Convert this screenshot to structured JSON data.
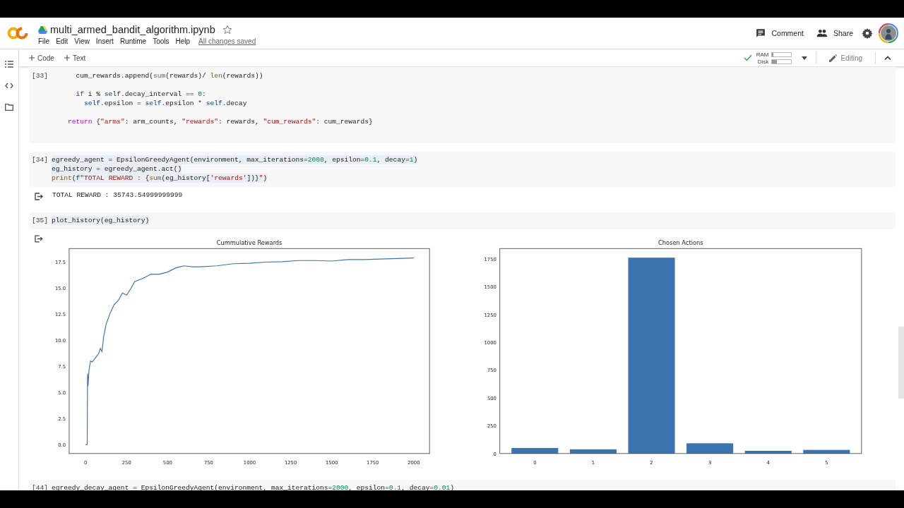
{
  "header": {
    "title": "multi_armed_bandit_algorithm.ipynb",
    "starred": false,
    "menu": [
      "File",
      "Edit",
      "View",
      "Insert",
      "Runtime",
      "Tools",
      "Help"
    ],
    "save_status": "All changes saved",
    "comment": "Comment",
    "share": "Share"
  },
  "toolbar": {
    "add_code": "Code",
    "add_text": "Text",
    "ram": {
      "label": "RAM",
      "level": 0.05
    },
    "disk": {
      "label": "Disk",
      "level": 0.25
    },
    "connected": true,
    "mode": "Editing"
  },
  "cells": [
    {
      "kind": "code",
      "count": "[33]",
      "highlighted": false,
      "lines": [
        {
          "blank_before": false,
          "tokens": [
            {
              "t": "      cum_rewards.append(",
              "kind": "plain"
            },
            {
              "t": "sum",
              "kind": "fn"
            },
            {
              "t": "(rewards)/ ",
              "kind": "plain"
            },
            {
              "t": "len",
              "kind": "fn"
            },
            {
              "t": "(rewards))",
              "kind": "plain"
            }
          ]
        },
        {
          "blank_before": true,
          "tokens": [
            {
              "t": "      if",
              "kind": "kw"
            },
            {
              "t": " i % ",
              "kind": "plain"
            },
            {
              "t": "self",
              "kind": "self"
            },
            {
              "t": ".decay_interval == ",
              "kind": "plain"
            },
            {
              "t": "0",
              "kind": "num"
            },
            {
              "t": ":",
              "kind": "plain"
            }
          ]
        },
        {
          "blank_before": false,
          "tokens": [
            {
              "t": "        self",
              "kind": "self"
            },
            {
              "t": ".epsilon = ",
              "kind": "plain"
            },
            {
              "t": "self",
              "kind": "self"
            },
            {
              "t": ".epsilon * ",
              "kind": "plain"
            },
            {
              "t": "self",
              "kind": "self"
            },
            {
              "t": ".decay",
              "kind": "plain"
            }
          ]
        },
        {
          "blank_before": true,
          "tokens": [
            {
              "t": "    return",
              "kind": "kw"
            },
            {
              "t": " {",
              "kind": "plain"
            },
            {
              "t": "\"arms\"",
              "kind": "str"
            },
            {
              "t": ": arm_counts, ",
              "kind": "plain"
            },
            {
              "t": "\"rewards\"",
              "kind": "str"
            },
            {
              "t": ": rewards, ",
              "kind": "plain"
            },
            {
              "t": "\"cum_rewards\"",
              "kind": "str"
            },
            {
              "t": ": cum_rewards}",
              "kind": "plain"
            }
          ]
        }
      ]
    },
    {
      "kind": "code",
      "count": "[34]",
      "highlighted": true,
      "lines": [
        {
          "blank_before": false,
          "tokens": [
            {
              "t": "egreedy_agent = EpsilonGreedyAgent(environment, max_iterations=",
              "kind": "plain"
            },
            {
              "t": "2000",
              "kind": "num"
            },
            {
              "t": ", epsilon=",
              "kind": "plain"
            },
            {
              "t": "0.1",
              "kind": "num"
            },
            {
              "t": ", decay=",
              "kind": "plain"
            },
            {
              "t": "1",
              "kind": "num"
            },
            {
              "t": ")",
              "kind": "plain"
            }
          ]
        },
        {
          "blank_before": false,
          "tokens": [
            {
              "t": "eg_history = egreedy_agent.act()",
              "kind": "plain"
            }
          ]
        },
        {
          "blank_before": false,
          "tokens": [
            {
              "t": "print",
              "kind": "fn"
            },
            {
              "t": "(",
              "kind": "plain"
            },
            {
              "t": "f",
              "kind": "self"
            },
            {
              "t": "\"TOTAL REWARD : ",
              "kind": "str"
            },
            {
              "t": "{",
              "kind": "plain"
            },
            {
              "t": "sum",
              "kind": "fn"
            },
            {
              "t": "(eg_history[",
              "kind": "plain"
            },
            {
              "t": "'rewards'",
              "kind": "str"
            },
            {
              "t": "])}",
              "kind": "plain"
            },
            {
              "t": "\"",
              "kind": "str"
            },
            {
              "t": ")",
              "kind": "plain"
            }
          ]
        }
      ]
    },
    {
      "kind": "text_output",
      "text": "TOTAL REWARD : 35743.54999999999"
    },
    {
      "kind": "code",
      "count": "[35]",
      "highlighted": true,
      "lines": [
        {
          "blank_before": false,
          "tokens": [
            {
              "t": "plot_history(eg_history)",
              "kind": "plain"
            }
          ]
        }
      ]
    },
    {
      "kind": "chart_output",
      "charts": [
        {
          "chart_data": {
            "type": "line",
            "title": "Cummulative Rewards",
            "x": [
              0,
              10,
              12,
              15,
              20,
              30,
              40,
              60,
              80,
              90,
              100,
              110,
              125,
              150,
              175,
              200,
              225,
              250,
              275,
              300,
              350,
              400,
              450,
              500,
              550,
              600,
              650,
              700,
              800,
              900,
              1000,
              1100,
              1200,
              1300,
              1400,
              1500,
              1600,
              1700,
              1800,
              1900,
              2000
            ],
            "series": [
              {
                "color": "#3b75af",
                "values": [
                  0,
                  0,
                  6.8,
                  5.6,
                  7.0,
                  8.0,
                  7.9,
                  8.3,
                  8.7,
                  9.2,
                  8.9,
                  10.3,
                  11.5,
                  12.6,
                  13.4,
                  13.8,
                  14.5,
                  14.3,
                  14.9,
                  15.6,
                  15.9,
                  16.3,
                  16.3,
                  16.5,
                  16.9,
                  17.1,
                  17.0,
                  17.0,
                  17.1,
                  17.3,
                  17.35,
                  17.45,
                  17.5,
                  17.6,
                  17.6,
                  17.55,
                  17.7,
                  17.7,
                  17.75,
                  17.8,
                  17.85
                ]
              }
            ],
            "xlim": [
              -100,
              2096
            ],
            "ylim": [
              -0.85,
              18.75
            ],
            "xticks": [
              0,
              250,
              500,
              750,
              1000,
              1250,
              1500,
              1750,
              2000
            ],
            "yticks": [
              {
                "value": 0,
                "label": "0.0"
              },
              {
                "value": 2.5,
                "label": "2.5"
              },
              {
                "value": 5,
                "label": "5.0"
              },
              {
                "value": 7.5,
                "label": "7.5"
              },
              {
                "value": 10,
                "label": "10.0"
              },
              {
                "value": 12.5,
                "label": "12.5"
              },
              {
                "value": 15,
                "label": "15.0"
              },
              {
                "value": 17.5,
                "label": "17.5"
              }
            ]
          }
        },
        {
          "chart_data": {
            "type": "bar",
            "title": "Chosen Actions",
            "categories": [
              "0",
              "1",
              "2",
              "3",
              "4",
              "5"
            ],
            "series": [
              {
                "color": "#3b75af",
                "values": [
                  50,
                  38,
                  1760,
                  92,
                  25,
                  33
                ]
              }
            ],
            "ylim": [
              0,
              1842
            ],
            "yticks": [
              0,
              250,
              500,
              750,
              1000,
              1250,
              1500,
              1750
            ]
          }
        }
      ]
    },
    {
      "kind": "code",
      "count": "[44]",
      "highlighted": false,
      "lines": [
        {
          "blank_before": false,
          "tokens": [
            {
              "t": "egreedy_decay_agent = EpsilonGreedyAgent(environment, max_iterations=",
              "kind": "plain"
            },
            {
              "t": "2000",
              "kind": "num"
            },
            {
              "t": ", epsilon=",
              "kind": "plain"
            },
            {
              "t": "0.1",
              "kind": "num"
            },
            {
              "t": ", decay=",
              "kind": "plain"
            },
            {
              "t": "0.01",
              "kind": "num"
            },
            {
              "t": ")",
              "kind": "plain"
            }
          ]
        }
      ]
    }
  ]
}
